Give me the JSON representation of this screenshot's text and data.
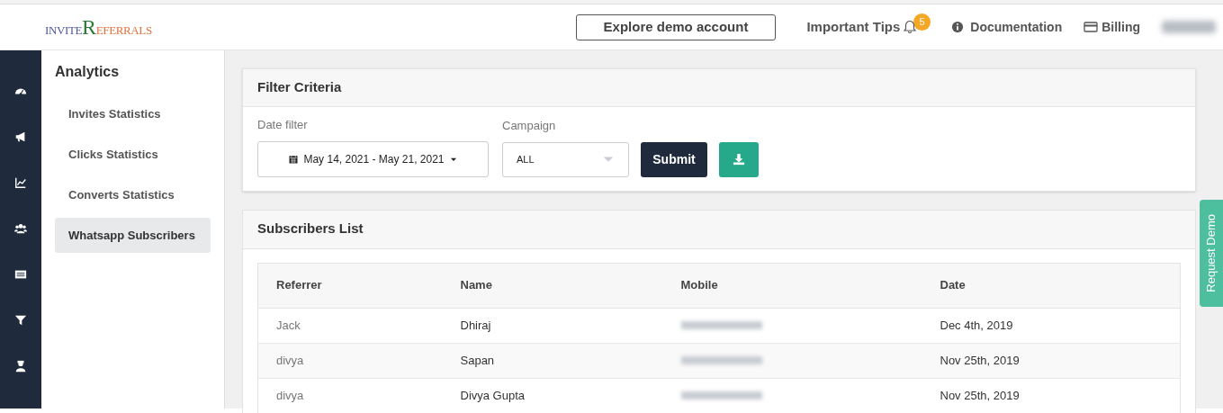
{
  "header": {
    "logo": [
      "INVITE",
      "R",
      "EFERRALS"
    ],
    "demo_button": "Explore demo account",
    "tips": {
      "label": "Important Tips",
      "badge": "5"
    },
    "links": [
      {
        "kind": "info",
        "label": "Documentation"
      },
      {
        "kind": "card",
        "label": "Billing"
      }
    ]
  },
  "submenu": {
    "title": "Analytics",
    "items": [
      {
        "label": "Invites Statistics",
        "selected": false
      },
      {
        "label": "Clicks Statistics",
        "selected": false
      },
      {
        "label": "Converts Statistics",
        "selected": false
      },
      {
        "label": "Whatsapp Subscribers",
        "selected": true
      }
    ]
  },
  "filter": {
    "title": "Filter Criteria",
    "date_label": "Date filter",
    "date_value": "May 14, 2021 - May 21, 2021",
    "campaign_label": "Campaign",
    "campaign_value": "ALL",
    "submit": "Submit"
  },
  "subscribers": {
    "title": "Subscribers List",
    "columns": [
      "Referrer",
      "Name",
      "Mobile",
      "Date"
    ],
    "rows": [
      {
        "referrer": "Jack",
        "name": "Dhiraj",
        "date": "Dec 4th, 2019"
      },
      {
        "referrer": "divya",
        "name": "Sapan",
        "date": "Nov 25th, 2019"
      },
      {
        "referrer": "divya",
        "name": "Divya Gupta",
        "date": "Nov 25th, 2019"
      }
    ]
  },
  "request_demo": "Request Demo"
}
